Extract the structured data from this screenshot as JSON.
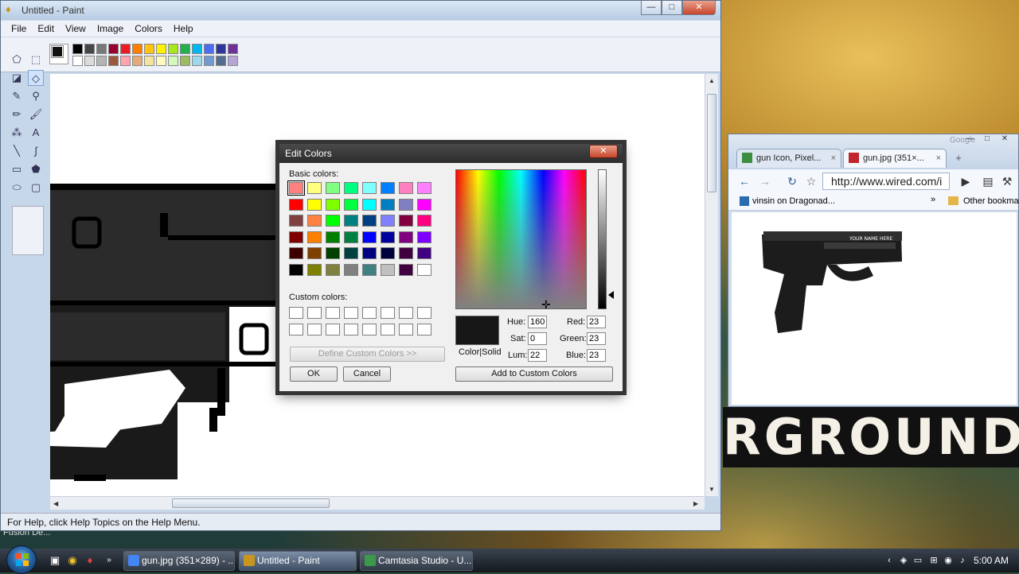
{
  "desktop": {
    "graffiti_text": "RGROUND",
    "label": "Fusion De..."
  },
  "paint": {
    "title": "Untitled - Paint",
    "window_buttons": {
      "minimize": "—",
      "maximize": "□",
      "close": "✕"
    },
    "menu": [
      "File",
      "Edit",
      "View",
      "Image",
      "Colors",
      "Help"
    ],
    "palette_row1": [
      "#000000",
      "#7f7f7f",
      "#880015",
      "#ed1c24",
      "#ff7f27",
      "#fff200",
      "#22b14c",
      "#00a2e8",
      "#3f48cc",
      "#a349a4",
      "#000000",
      "#404040",
      "#808080",
      "#c0c0c0",
      "#e0e0e0"
    ],
    "palette": [
      [
        "#000000",
        "#464646",
        "#787878",
        "#990030",
        "#ed1c24",
        "#ff7e00",
        "#ffc20e",
        "#fff200",
        "#a8e61d",
        "#22b14c",
        "#00b7ef",
        "#4d6df3",
        "#2f3699",
        "#6f3198"
      ],
      [
        "#ffffff",
        "#dcdcdc",
        "#b4b4b4",
        "#9c5a3c",
        "#ffa3b1",
        "#e5aa7a",
        "#f5e49c",
        "#fff9bd",
        "#d3f9bc",
        "#9dbb61",
        "#99d9ea",
        "#709ad1",
        "#546d8e",
        "#b5a5d5"
      ]
    ],
    "status_text": "For Help, click Help Topics on the Help Menu.",
    "tool_icons": [
      "free-select-icon",
      "rect-select-icon",
      "eraser-icon",
      "fill-icon",
      "picker-icon",
      "magnifier-icon",
      "pencil-icon",
      "brush-icon",
      "airbrush-icon",
      "text-icon",
      "line-icon",
      "curve-icon",
      "rectangle-icon",
      "polygon-icon",
      "ellipse-icon",
      "rounded-rect-icon"
    ]
  },
  "dialog": {
    "title": "Edit Colors",
    "basic_label": "Basic colors:",
    "basic_colors": [
      "#ff8080",
      "#ffff80",
      "#80ff80",
      "#00ff80",
      "#80ffff",
      "#0080ff",
      "#ff80c0",
      "#ff80ff",
      "#ff0000",
      "#ffff00",
      "#80ff00",
      "#00ff40",
      "#00ffff",
      "#0080c0",
      "#8080c0",
      "#ff00ff",
      "#804040",
      "#ff8040",
      "#00ff00",
      "#008080",
      "#004080",
      "#8080ff",
      "#800040",
      "#ff0080",
      "#800000",
      "#ff8000",
      "#008000",
      "#008040",
      "#0000ff",
      "#0000a0",
      "#800080",
      "#8000ff",
      "#400000",
      "#804000",
      "#004000",
      "#004040",
      "#000080",
      "#000040",
      "#400040",
      "#400080",
      "#000000",
      "#808000",
      "#808040",
      "#808080",
      "#408080",
      "#c0c0c0",
      "#400040",
      "#ffffff"
    ],
    "custom_label": "Custom colors:",
    "define_button": "Define Custom Colors >>",
    "ok_button": "OK",
    "cancel_button": "Cancel",
    "colorsolid_label": "Color|Solid",
    "hue_label": "Hue:",
    "hue_value": "160",
    "sat_label": "Sat:",
    "sat_value": "0",
    "lum_label": "Lum:",
    "lum_value": "22",
    "red_label": "Red:",
    "red_value": "23",
    "green_label": "Green:",
    "green_value": "23",
    "blue_label": "Blue:",
    "blue_value": "23",
    "add_button": "Add to Custom Colors",
    "current_color": "#171717"
  },
  "chrome": {
    "tabs": [
      {
        "label": "gun Icon, Pixel...",
        "close": "×"
      },
      {
        "label": "gun.jpg (351×...",
        "close": "×"
      }
    ],
    "new_tab": "+",
    "watermark": "Google",
    "url": "http://www.wired.com/i",
    "bookmarks": {
      "item1": "vinsin on Dragonad...",
      "chevron": "»",
      "other": "Other bookma"
    },
    "gun_label": "YOUR NAME HERE"
  },
  "taskbar": {
    "tasks": [
      {
        "label": "gun.jpg (351×289) - ...",
        "color": "#4285f4"
      },
      {
        "label": "Untitled - Paint",
        "color": "#c8961f"
      },
      {
        "label": "Camtasia Studio - U...",
        "color": "#3a9a4a"
      }
    ],
    "clock": "5:00 AM",
    "tray_chevron": "‹"
  }
}
